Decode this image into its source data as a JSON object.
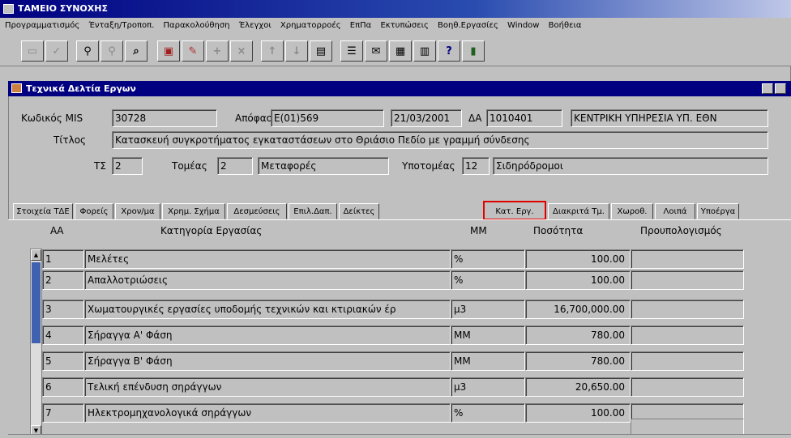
{
  "window": {
    "title": "ΤΑΜΕΙΟ ΣΥΝΟΧΗΣ"
  },
  "menu": [
    "Προγραμματισμός",
    "Ένταξη/Τροποπ.",
    "Παρακολούθηση",
    "Έλεγχοι",
    "Χρηματορροές",
    "ΕπΠα",
    "Εκτυπώσεις",
    "Βοηθ.Εργασίες",
    "Window",
    "Βοήθεια"
  ],
  "toolbar": [
    {
      "icon": "save-icon",
      "glyph": "▭"
    },
    {
      "icon": "check-icon",
      "glyph": "✓"
    },
    {
      "icon": "find-icon",
      "glyph": "⚲"
    },
    {
      "icon": "find-all-icon",
      "glyph": "⚲"
    },
    {
      "icon": "query-icon",
      "glyph": "⌕"
    },
    {
      "icon": "form-icon",
      "glyph": "▣"
    },
    {
      "icon": "edit-icon",
      "glyph": "✎"
    },
    {
      "icon": "add-record-icon",
      "glyph": "+"
    },
    {
      "icon": "delete-record-icon",
      "glyph": "×"
    },
    {
      "icon": "move-up-icon",
      "glyph": "↑"
    },
    {
      "icon": "move-down-icon",
      "glyph": "↓"
    },
    {
      "icon": "print-icon",
      "glyph": "▤"
    },
    {
      "icon": "list-icon",
      "glyph": "☰"
    },
    {
      "icon": "notes-icon",
      "glyph": "✉"
    },
    {
      "icon": "report-icon",
      "glyph": "▦"
    },
    {
      "icon": "clipboard-icon",
      "glyph": "▥"
    },
    {
      "icon": "help-icon",
      "glyph": "?"
    },
    {
      "icon": "exit-icon",
      "glyph": "▮"
    }
  ],
  "form": {
    "title": "Τεχνικά Δελτία Εργων",
    "mis_label": "Κωδικός MIS",
    "mis_value": "30728",
    "decision_label": "Απόφαση",
    "decision_value": "Ε(01)569",
    "decision_date": "21/03/2001",
    "da_label": "ΔΑ",
    "da_code": "1010401",
    "da_name": "ΚΕΝΤΡΙΚΗ ΥΠΗΡΕΣΙΑ ΥΠ. ΕΘΝ",
    "title_label": "Τίτλος",
    "title_value": "Κατασκευή συγκροτήματος εγκαταστάσεων στο Θριάσιο Πεδίο με γραμμή σύνδεσης",
    "ts_label": "ΤΣ",
    "ts_value": "2",
    "sector_label": "Τομέας",
    "sector_code": "2",
    "sector_name": "Μεταφορές",
    "subsector_label": "Υποτομέας",
    "subsector_code": "12",
    "subsector_name": "Σιδηρόδρομοι"
  },
  "tabs": [
    "Στοιχεία ΤΔΕ",
    "Φορείς",
    "Χρον/μα",
    "Χρημ. Σχήμα",
    "Δεσμεύσεις",
    "Επιλ.Δαπ.",
    "Δείκτες",
    "Κατ. Εργ.",
    "Διακριτά Τμ.",
    "Χωροθ.",
    "Λοιπά",
    "Υποέργα"
  ],
  "active_tab": "Κατ. Εργ.",
  "table": {
    "headers": {
      "aa": "ΑΑ",
      "category": "Κατηγορία Εργασίας",
      "mm": "ΜΜ",
      "quantity": "Ποσότητα",
      "budget": "Προυπολογισμός"
    },
    "rows": [
      {
        "aa": "1",
        "category": "Μελέτες",
        "mm": "%",
        "quantity": "100.00",
        "budget": ""
      },
      {
        "aa": "2",
        "category": "Απαλλοτριώσεις",
        "mm": "%",
        "quantity": "100.00",
        "budget": ""
      },
      {
        "aa": "3",
        "category": "Χωματουργικές εργασίες υποδομής τεχνικών και κτιριακών έρ",
        "mm": "μ3",
        "quantity": "16,700,000.00",
        "budget": ""
      },
      {
        "aa": "4",
        "category": "Σήραγγα Α' Φάση",
        "mm": "ΜΜ",
        "quantity": "780.00",
        "budget": ""
      },
      {
        "aa": "5",
        "category": "Σήραγγα Β' Φάση",
        "mm": "ΜΜ",
        "quantity": "780.00",
        "budget": ""
      },
      {
        "aa": "6",
        "category": "Τελική επένδυση σηράγγων",
        "mm": "μ3",
        "quantity": "20,650.00",
        "budget": ""
      },
      {
        "aa": "7",
        "category": "Ηλεκτρομηχανολογικά σηράγγων",
        "mm": "%",
        "quantity": "100.00",
        "budget": ""
      }
    ]
  },
  "colors": {
    "title_bar": "#000080",
    "panel": "#c0c0c0",
    "active_tab_border": "#e00000"
  }
}
